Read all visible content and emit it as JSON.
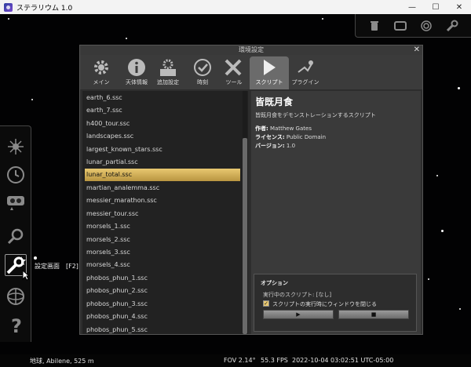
{
  "window": {
    "title": "ステラリウム 1.0",
    "controls": {
      "minimize": "—",
      "maximize": "☐",
      "close": "✕"
    }
  },
  "top_toolbar": {
    "icons": [
      "trash-icon",
      "window-icon",
      "galaxy-icon",
      "wrench-icon"
    ]
  },
  "left_toolbar": {
    "tooltip": "設定画面　[F2]",
    "icons": [
      "sky-view-icon",
      "clock-icon",
      "search-icon",
      "magnifier-icon",
      "config-icon",
      "location-icon",
      "help-icon"
    ]
  },
  "dialog": {
    "title": "環境設定",
    "close": "✕",
    "tabs": [
      {
        "label": "メイン",
        "icon": "gear-icon"
      },
      {
        "label": "天体情報",
        "icon": "info-icon"
      },
      {
        "label": "追加設定",
        "icon": "extras-icon"
      },
      {
        "label": "時刻",
        "icon": "time-icon"
      },
      {
        "label": "ツール",
        "icon": "tools-icon"
      },
      {
        "label": "スクリプト",
        "icon": "play-icon",
        "selected": true
      },
      {
        "label": "プラグイン",
        "icon": "plugin-icon"
      }
    ],
    "scripts": [
      "earth_6.ssc",
      "earth_7.ssc",
      "h400_tour.ssc",
      "landscapes.ssc",
      "largest_known_stars.ssc",
      "lunar_partial.ssc",
      "lunar_total.ssc",
      "martian_analemma.ssc",
      "messier_marathon.ssc",
      "messier_tour.ssc",
      "morsels_1.ssc",
      "morsels_2.ssc",
      "morsels_3.ssc",
      "morsels_4.ssc",
      "phobos_phun_1.ssc",
      "phobos_phun_2.ssc",
      "phobos_phun_3.ssc",
      "phobos_phun_4.ssc",
      "phobos_phun_5.ssc"
    ],
    "selected_script": "lunar_total.ssc",
    "detail": {
      "title": "皆既月食",
      "description": "皆既月食をデモンストレーションするスクリプト",
      "author_label": "作者:",
      "author": "Matthew Gates",
      "license_label": "ライセンス:",
      "license": "Public Domain",
      "version_label": "バージョン:",
      "version": "1.0"
    },
    "options": {
      "title": "オプション",
      "running": "実行中のスクリプト: [なし]",
      "close_window_label": "スクリプトの実行時にウィンドウを閉じる",
      "close_window_checked": true,
      "run_button": "▶",
      "stop_button": "■"
    }
  },
  "status_bar": {
    "location": "地球, Abilene, 525 m",
    "fov": "FOV 2.14°",
    "fps": "55.3 FPS",
    "datetime": "2022-10-04 03:02:51 UTC-05:00"
  },
  "colors": {
    "selection": "#d8b35a",
    "panel": "#2d2d2d",
    "sky": "#020203"
  }
}
